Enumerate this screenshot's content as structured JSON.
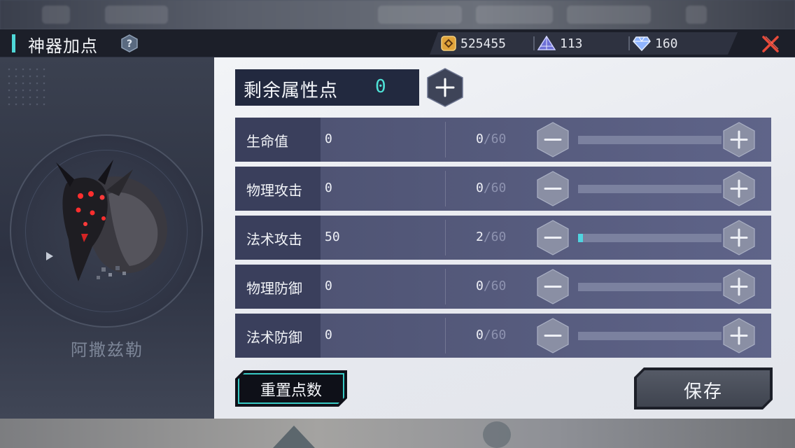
{
  "header": {
    "title": "神器加点",
    "currencies": [
      {
        "icon": "gold-coin-icon",
        "value": "525455"
      },
      {
        "icon": "crystal-pyramid-icon",
        "value": "113"
      },
      {
        "icon": "diamond-gem-icon",
        "value": "160"
      }
    ]
  },
  "artifact": {
    "name": "阿撒兹勒"
  },
  "points": {
    "label": "剩余属性点",
    "value": "0"
  },
  "stats": [
    {
      "name": "生命值",
      "value": "0",
      "level": "0",
      "max": "/60",
      "progress": 0.0
    },
    {
      "name": "物理攻击",
      "value": "0",
      "level": "0",
      "max": "/60",
      "progress": 0.0
    },
    {
      "name": "法术攻击",
      "value": "50",
      "level": "2",
      "max": "/60",
      "progress": 0.033
    },
    {
      "name": "物理防御",
      "value": "0",
      "level": "0",
      "max": "/60",
      "progress": 0.0
    },
    {
      "name": "法术防御",
      "value": "0",
      "level": "0",
      "max": "/60",
      "progress": 0.0
    }
  ],
  "buttons": {
    "reset": "重置点数",
    "save": "保存"
  },
  "colors": {
    "accent": "#4fe3d8",
    "close": "#e84a3a",
    "panel_dark": "#22293f"
  }
}
